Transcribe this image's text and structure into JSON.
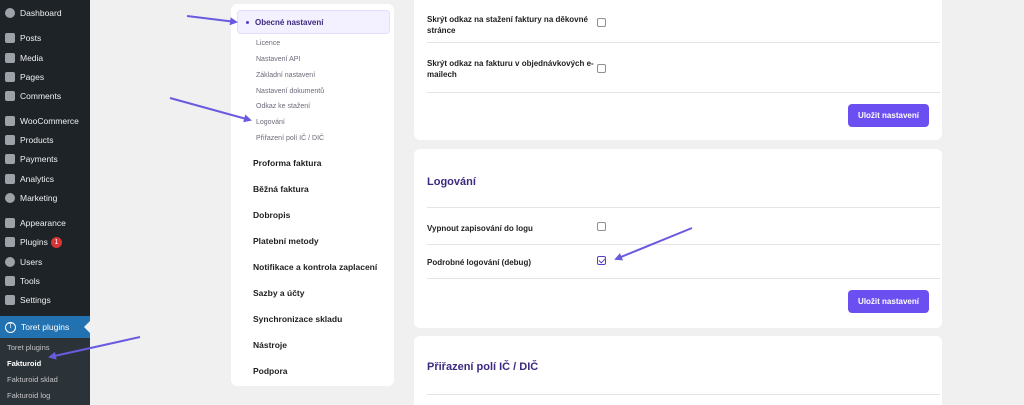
{
  "wp_menu": {
    "items": [
      {
        "label": "Dashboard",
        "icon": "dashboard-icon"
      },
      {
        "label": "Posts",
        "icon": "posts-icon"
      },
      {
        "label": "Media",
        "icon": "media-icon"
      },
      {
        "label": "Pages",
        "icon": "pages-icon"
      },
      {
        "label": "Comments",
        "icon": "comments-icon"
      },
      {
        "label": "WooCommerce",
        "icon": "woocommerce-icon"
      },
      {
        "label": "Products",
        "icon": "products-icon"
      },
      {
        "label": "Payments",
        "icon": "payments-icon"
      },
      {
        "label": "Analytics",
        "icon": "analytics-icon"
      },
      {
        "label": "Marketing",
        "icon": "marketing-icon"
      },
      {
        "label": "Appearance",
        "icon": "appearance-icon"
      },
      {
        "label": "Plugins",
        "icon": "plugins-icon",
        "badge": "1"
      },
      {
        "label": "Users",
        "icon": "users-icon"
      },
      {
        "label": "Tools",
        "icon": "tools-icon"
      },
      {
        "label": "Settings",
        "icon": "settings-icon"
      }
    ],
    "current": {
      "label": "Toret plugins",
      "icon": "toret-icon",
      "icon_glyph": "T"
    },
    "submenu": [
      "Toret plugins",
      "Fakturoid",
      "Fakturoid sklad",
      "Fakturoid log"
    ]
  },
  "settings_nav": {
    "active": "Obecné nastavení",
    "subitems": [
      "Licence",
      "Nastavení API",
      "Základní nastavení",
      "Nastavení dokumentů",
      "Odkaz ke stažení",
      "Logování",
      "Přiřazení polí IČ / DIČ"
    ],
    "sections": [
      "Proforma faktura",
      "Běžná faktura",
      "Dobropis",
      "Platební metody",
      "Notifikace a kontrola zaplacení",
      "Sazby a účty",
      "Synchronizace skladu",
      "Nástroje",
      "Podpora"
    ]
  },
  "card_top": {
    "row1_line1": "Skrýt odkaz na stažení faktury na děkovné",
    "row1_line2": "stránce",
    "row1_checked": false,
    "row2_line1": "Skrýt odkaz na fakturu v objednávkových e-",
    "row2_line2": "mailech",
    "row2_checked": false,
    "save_label": "Uložit nastavení"
  },
  "card_logging": {
    "title": "Logování",
    "row1_label": "Vypnout zapisování do logu",
    "row1_checked": false,
    "row2_label": "Podrobné logování (debug)",
    "row2_checked": true,
    "save_label": "Uložit nastavení"
  },
  "card_ic": {
    "title": "Přiřazení polí IČ / DIČ"
  },
  "colors": {
    "accent": "#6c4ff0",
    "title": "#3d2a80",
    "wp_sidebar": "#1d2327",
    "wp_current": "#2271b1",
    "arrow": "#6a5ae0"
  }
}
